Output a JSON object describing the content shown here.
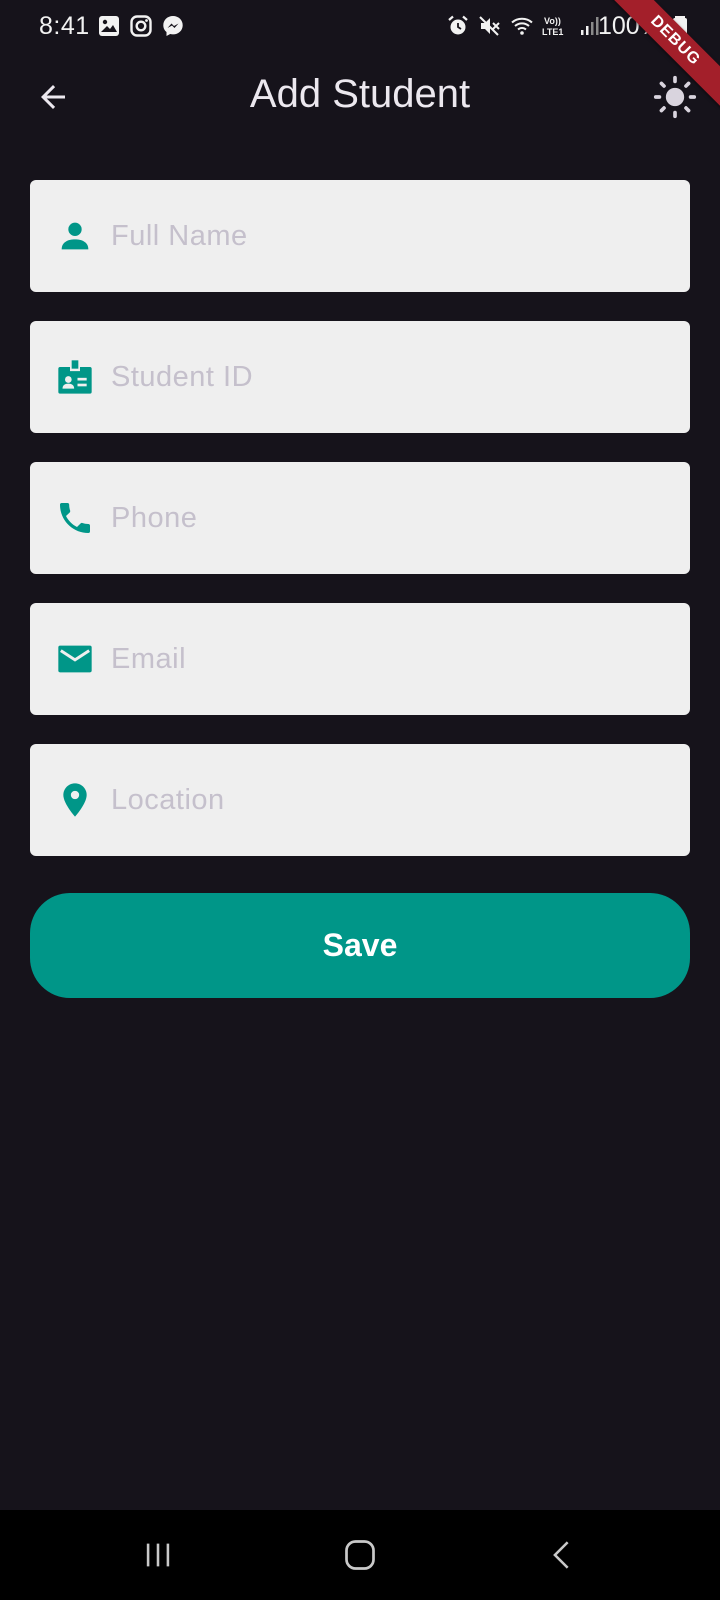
{
  "status_bar": {
    "time": "8:41",
    "battery": "100%",
    "left_icons": [
      "gallery-icon",
      "instagram-icon",
      "messenger-icon"
    ],
    "right_icons": [
      "alarm-icon",
      "mute-icon",
      "wifi-icon",
      "volte-icon",
      "signal-icon",
      "battery-icon"
    ]
  },
  "debug_banner": {
    "label": "DEBUG"
  },
  "app_bar": {
    "title": "Add Student",
    "back_icon": "arrow-back-icon",
    "theme_icon": "sun-icon"
  },
  "form": {
    "fields": [
      {
        "icon": "person-icon",
        "placeholder": "Full Name",
        "value": ""
      },
      {
        "icon": "badge-icon",
        "placeholder": "Student ID",
        "value": ""
      },
      {
        "icon": "phone-icon",
        "placeholder": "Phone",
        "value": ""
      },
      {
        "icon": "email-icon",
        "placeholder": "Email",
        "value": ""
      },
      {
        "icon": "location-pin-icon",
        "placeholder": "Location",
        "value": ""
      }
    ],
    "save_label": "Save"
  },
  "nav_bar": {
    "items": [
      "recent-apps-icon",
      "home-icon",
      "back-icon"
    ]
  },
  "colors": {
    "background": "#16131b",
    "accent": "#009688",
    "field_background": "#efefef",
    "placeholder": "#c5c0cc",
    "debug_ribbon": "#a31f2a"
  }
}
